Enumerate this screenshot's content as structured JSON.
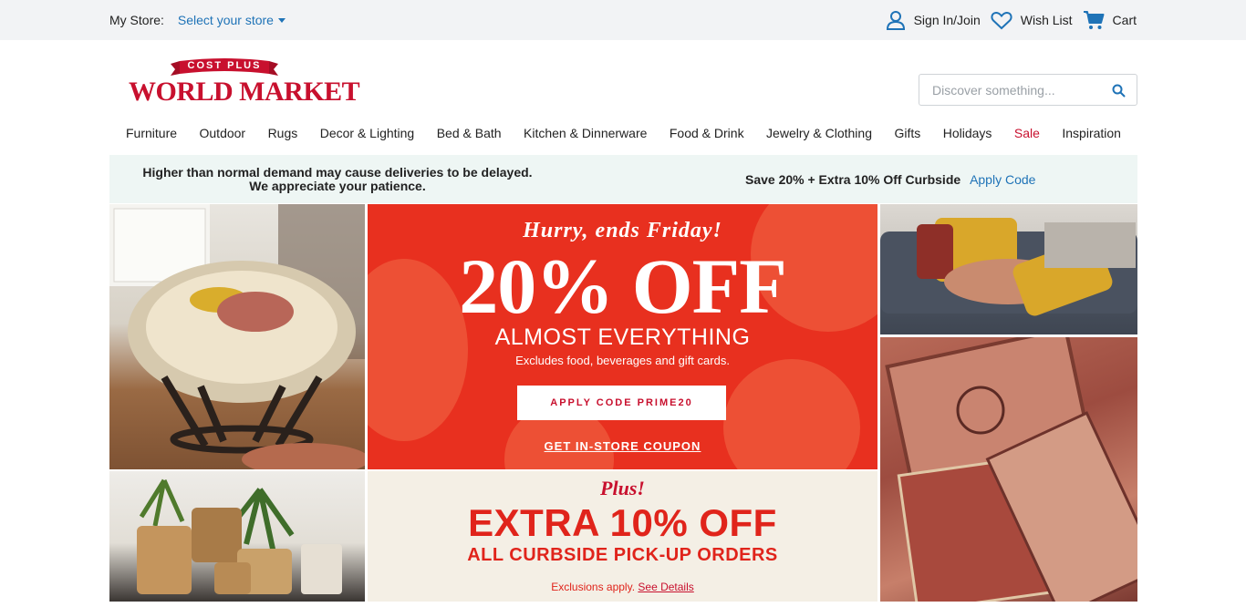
{
  "utility": {
    "my_store_label": "My Store:",
    "select_store_label": "Select your store",
    "sign_in_label": "Sign In/Join",
    "wishlist_label": "Wish List",
    "cart_label": "Cart"
  },
  "logo": {
    "banner": "COST PLUS",
    "name": "WORLD MARKET"
  },
  "search": {
    "placeholder": "Discover something..."
  },
  "nav": {
    "items": [
      "Furniture",
      "Outdoor",
      "Rugs",
      "Decor & Lighting",
      "Bed & Bath",
      "Kitchen & Dinnerware",
      "Food & Drink",
      "Jewelry & Clothing",
      "Gifts",
      "Holidays",
      "Sale",
      "Inspiration"
    ]
  },
  "notice": {
    "line1": "Higher than normal demand may cause deliveries to be delayed.",
    "line2": "We appreciate your patience.",
    "offer": "Save 20% + Extra 10% Off Curbside",
    "apply_code": "Apply Code"
  },
  "hero": {
    "hurry": "Hurry, ends Friday!",
    "discount": "20% OFF",
    "almost": "ALMOST EVERYTHING",
    "exclusions": "Excludes food, beverages and gift cards.",
    "apply_button": "APPLY CODE PRIME20",
    "coupon_link": "GET IN-STORE COUPON"
  },
  "curbside": {
    "plus": "Plus!",
    "extra": "EXTRA 10% OFF",
    "orders": "ALL CURBSIDE PICK-UP ORDERS",
    "exclusions": "Exclusions apply.",
    "see_details": "See Details"
  },
  "colors": {
    "brand_red": "#c8102e",
    "link_blue": "#1f73b7",
    "promo_red": "#e8301f",
    "notice_bg": "#eef6f4"
  }
}
